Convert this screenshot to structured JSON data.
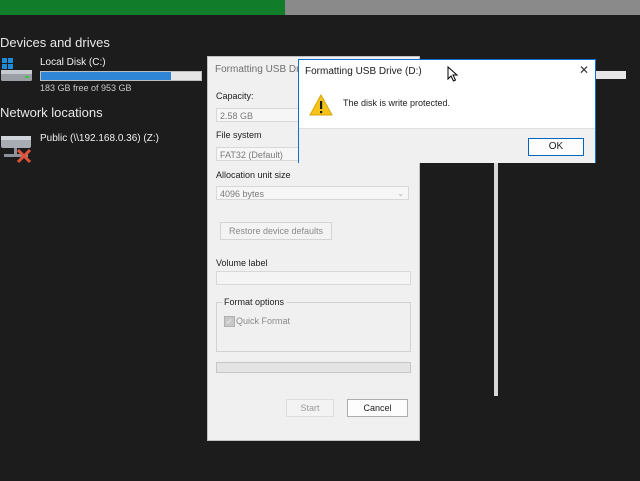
{
  "explorer": {
    "devices_title": "Devices and drives",
    "local_disk": {
      "name": "Local Disk (C:)",
      "free_text": "183 GB free of 953 GB",
      "used_fraction": 0.81
    },
    "network_title": "Network locations",
    "public_share": {
      "name": "Public (\\\\192.168.0.36) (Z:)"
    }
  },
  "format_dialog": {
    "title": "Formatting USB Dr",
    "capacity_label": "Capacity:",
    "capacity_value": "2.58 GB",
    "filesystem_label": "File system",
    "filesystem_value": "FAT32 (Default)",
    "allocation_label": "Allocation unit size",
    "allocation_value": "4096 bytes",
    "restore_label": "Restore device defaults",
    "volume_label": "Volume label",
    "volume_value": "",
    "format_options_label": "Format options",
    "quick_format_label": "Quick Format",
    "quick_format_checked": true,
    "start_label": "Start",
    "cancel_label": "Cancel"
  },
  "message_box": {
    "title": "Formatting USB Drive (D:)",
    "close_glyph": "✕",
    "text": "The disk is write protected.",
    "ok_label": "OK",
    "icon": "warning-icon"
  },
  "colors": {
    "accent": "#0067c0",
    "capacity_fill": "#2f86d6",
    "warning": "#f7c31b",
    "top_green": "#117d2b"
  }
}
